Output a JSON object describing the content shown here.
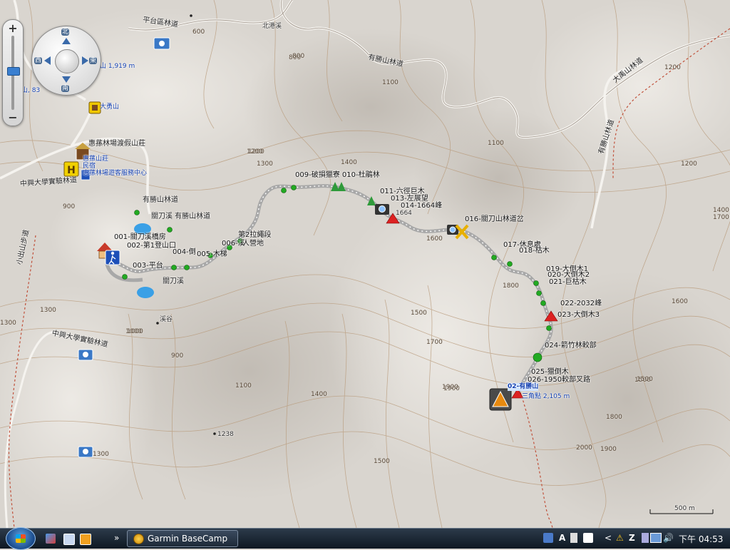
{
  "app": {
    "title": "Garmin BaseCamp"
  },
  "nav": {
    "north": "北",
    "south": "南",
    "east": "東",
    "west": "西"
  },
  "scale": {
    "label": "500 m"
  },
  "taskbar": {
    "app_button": "Garmin BaseCamp",
    "clock": "下午 04:53",
    "chevron": "»",
    "tray_chevron": "<"
  },
  "colors": {
    "track": "#a8a8a8",
    "waypoint": "#22aa22",
    "summit": "#dd2222",
    "trail_dash": "#c0503a"
  },
  "places": {
    "pingtai_road": "平台區林道",
    "beigang": "北港溪",
    "youshengshan_road_top": "有勝山林道",
    "youshengshan_road": "有勝山林道",
    "youshengshan_road2": "有勝山林道",
    "dayongshan": "大勇山",
    "huisun_lodge": "惠蓀林場渡假山莊",
    "lodge2": "惠蓀山莊",
    "minsu": "民宿",
    "service_center": "惠蓀林場遊客服務中心",
    "forest_road": "中興大學實驗林道",
    "forest_road2": "中興大學實驗林道",
    "guandao_river": "關刀溪",
    "guandao_river2": "關刀溪",
    "guandao_lin": "關刀溪 有勝山林道",
    "xiaochushan": "小出山步道",
    "budao": "步道",
    "right_road": "有勝山林道",
    "top_right_road": "大禹山林道",
    "stream_valley": "溪谷"
  },
  "peaks": {
    "p_left": "山 1,919 m",
    "p_left2": "山, 83",
    "p1238": "1238",
    "p1664": "1664",
    "youshengshan": "02-有勝山",
    "youshengshan_elev": "三角點 2,105 m"
  },
  "contours": [
    "600",
    "800",
    "900",
    "1000",
    "1100",
    "1200",
    "1300",
    "1400",
    "1500",
    "1600",
    "1700",
    "1800",
    "1900",
    "2000",
    "1300",
    "1500",
    "1600",
    "1700",
    "1800",
    "1900",
    "1100",
    "1200",
    "1400",
    "1500",
    "1300",
    "1100",
    "1000",
    "900",
    "800",
    "1200",
    "1400",
    "1200",
    "1300",
    "1500",
    "1900"
  ],
  "waypoints": [
    {
      "label": "001-關刀溪橋房"
    },
    {
      "label": "002-第1登山口"
    },
    {
      "label": "003-平台"
    },
    {
      "label": "004-倒"
    },
    {
      "label": "005-木梯"
    },
    {
      "label": "006-溪"
    },
    {
      "label": "第2拉繩段"
    },
    {
      "label": "人營地"
    },
    {
      "label": "009-破損獵寮 010-杜鵑林"
    },
    {
      "label": "011-六徑巨木"
    },
    {
      "label": "013-左展望"
    },
    {
      "label": "014-1664峰"
    },
    {
      "label": "016-關刀山林道岔"
    },
    {
      "label": "017-休息處"
    },
    {
      "label": "018-枯木"
    },
    {
      "label": "019-大倒木1"
    },
    {
      "label": "020-大倒木2"
    },
    {
      "label": "021-巨枯木"
    },
    {
      "label": "022-2032峰"
    },
    {
      "label": "023-大倒木3"
    },
    {
      "label": "024-箭竹林較部"
    },
    {
      "label": "025-獵倒木"
    },
    {
      "label": "026-1950較部叉路"
    }
  ]
}
